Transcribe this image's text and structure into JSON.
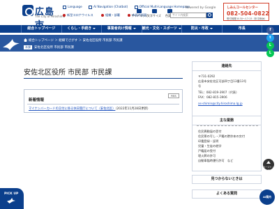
{
  "header": {
    "logo_text": "広島市",
    "logo_sub": "The City of Hiroshima",
    "top_links": [
      "Language",
      "AI Navigation (Chatbot)",
      "Official Multi-Language Homepage"
    ],
    "bottom_links": [
      "新型コロナウイルス",
      "組織・部署",
      "市長の部屋"
    ],
    "util_labels": [
      "サイトマップ",
      "文字サイズ",
      "色変更"
    ],
    "search_placeholder": "サイト内検索",
    "google_label": "Powered by Google",
    "contact_title": "しみんコールセンター",
    "contact_phone": "082-504-0822",
    "contact_hours": "受付時間 8:30〜17:15（年中無休）"
  },
  "nav": {
    "items": [
      "総合トップページ",
      "くらし・手続き",
      "事業者向け情報",
      "観光・文化・スポーツ",
      "防災・市政",
      "市長"
    ]
  },
  "breadcrumb": {
    "path": "総合トップページ ＞ 組織でさがす ＞ 安佐北区役所 市民部 市民課",
    "sub_label": "本課",
    "sub_text": "安佐北区役所 市民部 市民課"
  },
  "social": {
    "icons": [
      "f",
      "t",
      "L",
      "L"
    ],
    "colors": [
      "#3b5998",
      "#1da1f2",
      "#06c755",
      "#06c755"
    ]
  },
  "main": {
    "page_title": "安佐北区役所 市民部 市民課",
    "news_title": "新着情報",
    "rss_label": "RSS",
    "news_link": "マイナンバーカードの交付に係る休日開庁について（安佐北区）",
    "news_date": "（2022年11月28日更新）"
  },
  "side": {
    "contact_heading": "連絡先",
    "contact_lines": [
      "〒731-0292",
      "広島市安佐北区可部四丁目13番13号",
      "号",
      "TEL：082-819-3907（代表）",
      "FAX：082-815-3906"
    ],
    "contact_email": "as-shimin@city.hiroshima.lg.jp",
    "duties_heading": "主な業務",
    "duties": [
      "住民異動届の受付",
      "住民票の写し・戸籍の謄抄本の交付",
      "印鑑登録・証明",
      "児童・生徒の就学",
      "戸籍届の受付",
      "埋火葬の許可",
      "自動車臨時運行許可　など"
    ],
    "find_button": "見つからないときは",
    "faq_button": "よくある質問"
  },
  "float": {
    "pagetop_label": "ページトップ",
    "ai_label": "AI案内",
    "pickup_label": "PICK UP"
  }
}
